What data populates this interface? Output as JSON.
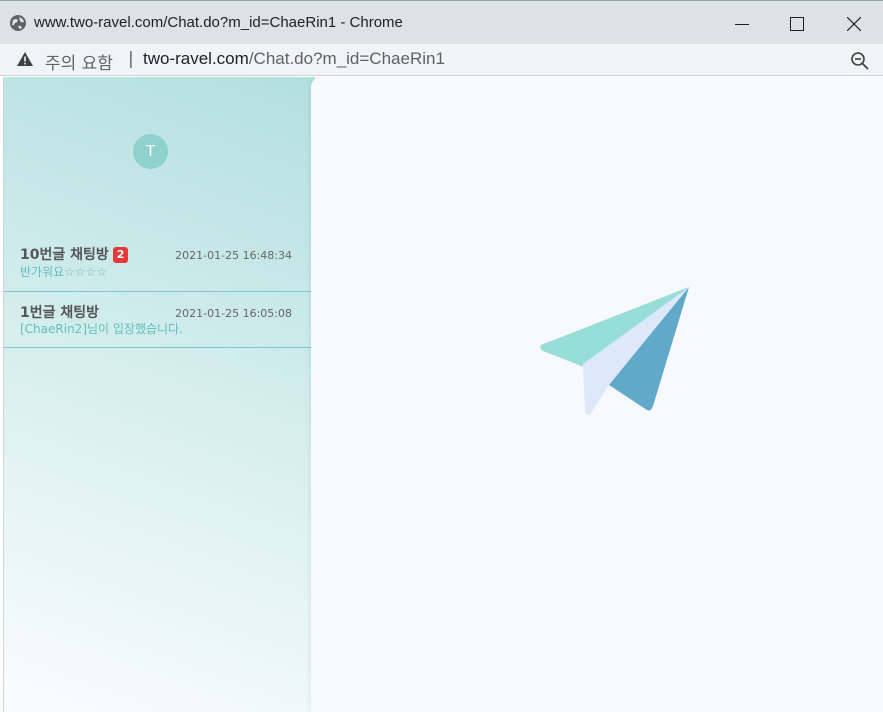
{
  "window": {
    "title": "www.two-ravel.com/Chat.do?m_id=ChaeRin1 - Chrome",
    "icons": {
      "site": "globe-icon",
      "minimize": "minimize-icon",
      "maximize": "maximize-icon",
      "close": "close-icon"
    }
  },
  "address_bar": {
    "warning_text": "주의 요함",
    "separator": "|",
    "url_host": "two-ravel.com",
    "url_path": "/Chat.do?m_id=ChaeRin1",
    "icons": {
      "warning": "warning-icon",
      "zoom": "zoom-icon"
    }
  },
  "sidebar": {
    "avatar_initial": "T",
    "rooms": [
      {
        "name": "10번글 채팅방",
        "unread": "2",
        "time": "2021-01-25 16:48:34",
        "last_message": "반가워요☆☆☆☆"
      },
      {
        "name": "1번글 채팅방",
        "unread": "",
        "time": "2021-01-25 16:05:08",
        "last_message": "[ChaeRin2]님이 입장했습니다."
      }
    ]
  },
  "main": {
    "icon": "paper-plane-icon"
  },
  "colors": {
    "sidebar_teal": "#b2e0df",
    "accent_teal": "#5fbfb9",
    "badge_red": "#e5383b",
    "main_bg": "#f8f9fe"
  }
}
